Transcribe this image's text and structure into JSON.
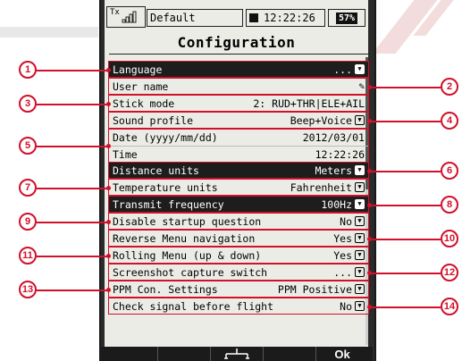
{
  "status": {
    "tx_label": "Tx",
    "model_name": "Default",
    "time": "12:22:26",
    "battery": "57%"
  },
  "title": "Configuration",
  "rows": [
    {
      "label": "Language",
      "value": "...",
      "dropdown": true,
      "dark": true,
      "callout": "1",
      "side": "left"
    },
    {
      "label": "User name",
      "value": "",
      "edit_icon": true,
      "dark": false,
      "callout": "2",
      "side": "right"
    },
    {
      "label": "Stick mode",
      "value": "2: RUD+THR|ELE+AIL",
      "dark": false,
      "callout": "3",
      "side": "left"
    },
    {
      "label": "Sound profile",
      "value": "Beep+Voice",
      "dropdown": true,
      "dark": false,
      "callout": "4",
      "side": "right"
    },
    {
      "label": "Date (yyyy/mm/dd)",
      "value": "2012/03/01",
      "dark": false,
      "callout": "5",
      "side": "left"
    },
    {
      "label": "Time",
      "value": "12:22:26",
      "dark": false
    },
    {
      "label": "Distance units",
      "value": "Meters",
      "dropdown": true,
      "dark": true,
      "callout": "6",
      "side": "right"
    },
    {
      "label": "Temperature units",
      "value": "Fahrenheit",
      "dropdown": true,
      "dark": false,
      "callout": "7",
      "side": "left"
    },
    {
      "label": "Transmit frequency",
      "value": "100Hz",
      "dropdown": true,
      "dark": true,
      "callout": "8",
      "side": "right"
    },
    {
      "label": "Disable startup question",
      "value": "No",
      "dropdown": true,
      "dark": false,
      "callout": "9",
      "side": "left"
    },
    {
      "label": "Reverse Menu navigation",
      "value": "Yes",
      "dropdown": true,
      "dark": false,
      "callout": "10",
      "side": "right"
    },
    {
      "label": "Rolling Menu (up & down)",
      "value": "Yes",
      "dropdown": true,
      "dark": false,
      "callout": "11",
      "side": "left"
    },
    {
      "label": "Screenshot capture switch",
      "value": "...",
      "dropdown": true,
      "dark": false,
      "callout": "12",
      "side": "right"
    },
    {
      "label": "PPM Con. Settings",
      "value": "PPM Positive",
      "dropdown": true,
      "dark": false,
      "callout": "13",
      "side": "left"
    },
    {
      "label": "Check signal before flight",
      "value": "No",
      "dropdown": true,
      "dark": false,
      "callout": "14",
      "side": "right"
    }
  ],
  "softkeys": {
    "center_icon": "tree-icon",
    "ok": "Ok"
  },
  "colors": {
    "accent": "#d1102a",
    "screen_bg": "#ecece6",
    "row_dark": "#1d1d1d"
  }
}
